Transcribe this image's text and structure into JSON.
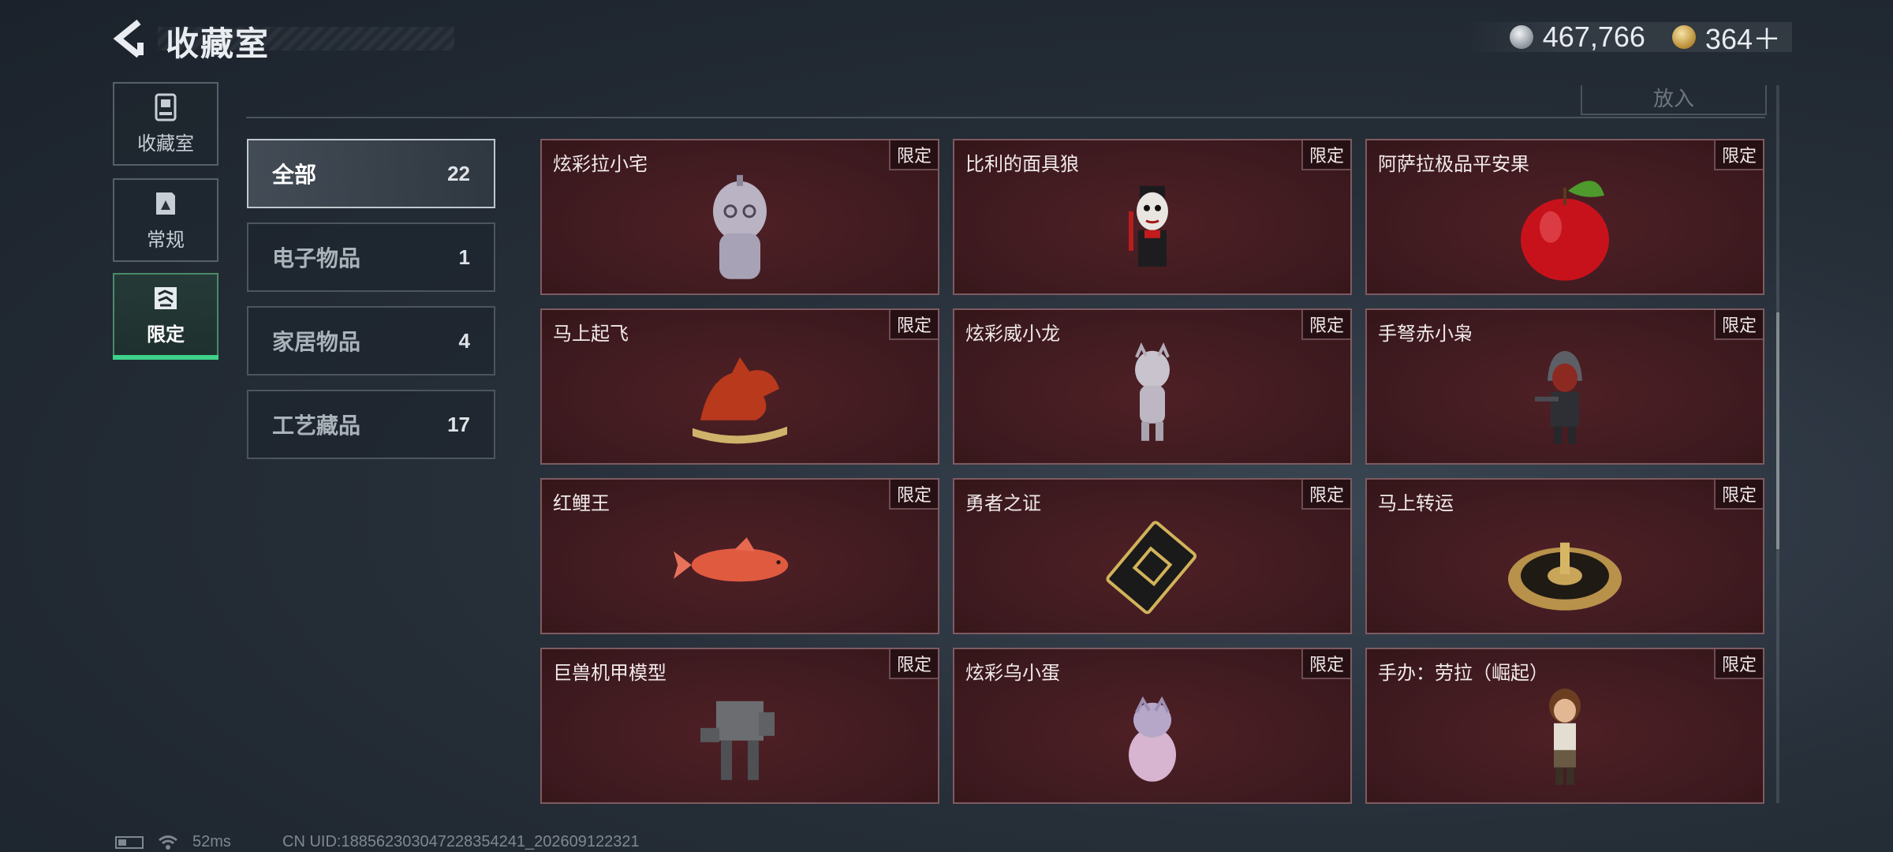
{
  "header": {
    "title": "收藏室",
    "currency": [
      {
        "icon": "silver-coin-icon",
        "value": "467,766"
      },
      {
        "icon": "gold-coin-icon",
        "value": "364＋"
      }
    ]
  },
  "side_tabs": [
    {
      "label": "收藏室",
      "icon": "collection-icon",
      "active": false
    },
    {
      "label": "常规",
      "icon": "regular-icon",
      "active": false
    },
    {
      "label": "限定",
      "icon": "limited-icon",
      "active": true
    }
  ],
  "put_button": "放入",
  "categories": [
    {
      "name": "全部",
      "count": "22",
      "active": true
    },
    {
      "name": "电子物品",
      "count": "1",
      "active": false
    },
    {
      "name": "家居物品",
      "count": "4",
      "active": false
    },
    {
      "name": "工艺藏品",
      "count": "17",
      "active": false
    }
  ],
  "items": [
    {
      "name": "炫彩拉小宅",
      "tag": "限定",
      "icon": "ghost-figure-icon"
    },
    {
      "name": "比利的面具狼",
      "tag": "限定",
      "icon": "puppet-figure-icon"
    },
    {
      "name": "阿萨拉极品平安果",
      "tag": "限定",
      "icon": "apple-icon"
    },
    {
      "name": "马上起飞",
      "tag": "限定",
      "icon": "horse-sculpture-icon"
    },
    {
      "name": "炫彩威小龙",
      "tag": "限定",
      "icon": "dragon-figure-icon"
    },
    {
      "name": "手弩赤小枭",
      "tag": "限定",
      "icon": "hooded-figure-icon"
    },
    {
      "name": "红鲤王",
      "tag": "限定",
      "icon": "carp-fish-icon"
    },
    {
      "name": "勇者之证",
      "tag": "限定",
      "icon": "card-badge-icon"
    },
    {
      "name": "马上转运",
      "tag": "限定",
      "icon": "lucky-wheel-icon"
    },
    {
      "name": "巨兽机甲模型",
      "tag": "限定",
      "icon": "mech-model-icon"
    },
    {
      "name": "炫彩乌小蛋",
      "tag": "限定",
      "icon": "egg-figure-icon"
    },
    {
      "name": "手办：劳拉（崛起）",
      "tag": "限定",
      "icon": "lara-figure-icon"
    }
  ],
  "status": {
    "ping": "52ms",
    "uid": "CN UID:18856230304722835424​1_202609122321"
  }
}
